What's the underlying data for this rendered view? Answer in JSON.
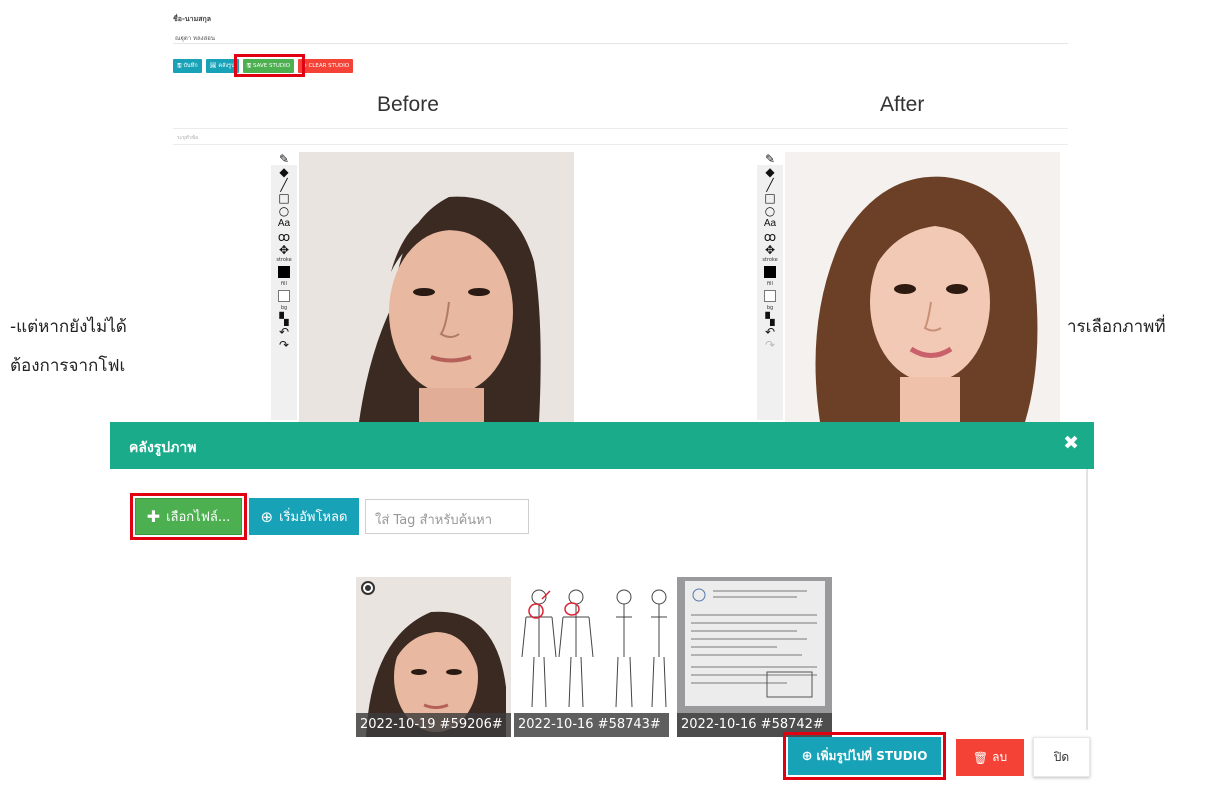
{
  "form": {
    "name_label": "ชื่อ-นามสกุล",
    "name_value": "ณฐุดา หลงสอน",
    "caption_placeholder": "ระบุหัวข้อ"
  },
  "toolbar": {
    "save_label": "บันทึก",
    "gallery_label": "คลังรูป",
    "save_studio_label": "SAVE STUDIO",
    "clear_studio_label": "CLEAR STUDIO"
  },
  "studio": {
    "before_title": "Before",
    "after_title": "After",
    "stroke_label": "stroke",
    "fill_label": "fill",
    "bg_label": "bg",
    "text_tool_label": "Aa"
  },
  "document_text": {
    "left_line1": "-แต่หากยังไม่ได้",
    "left_line2": "ต้องการจากโฟเ",
    "right_line1": "ารเลือกภาพที่"
  },
  "modal": {
    "title": "คลังรูปภาพ",
    "close_symbol": "✖",
    "choose_file_label": "เลือกไฟล์...",
    "upload_label": "เริ่มอัพโหลด",
    "tag_placeholder": "ใส่ Tag สำหรับค้นหา",
    "images": [
      {
        "caption": "2022-10-19 #59206#",
        "selected": true
      },
      {
        "caption": "2022-10-16 #58743#",
        "selected": false
      },
      {
        "caption": "2022-10-16 #58742#",
        "selected": false
      }
    ],
    "add_to_studio_label": "เพิ่มรูปไปที่ STUDIO",
    "delete_label": "ลบ",
    "close_label": "ปิด"
  },
  "colors": {
    "modal_header": "#1aab8b",
    "teal_button": "#17a2b8",
    "green_button": "#4caf50",
    "red_button": "#f44336",
    "highlight": "#e10012"
  }
}
